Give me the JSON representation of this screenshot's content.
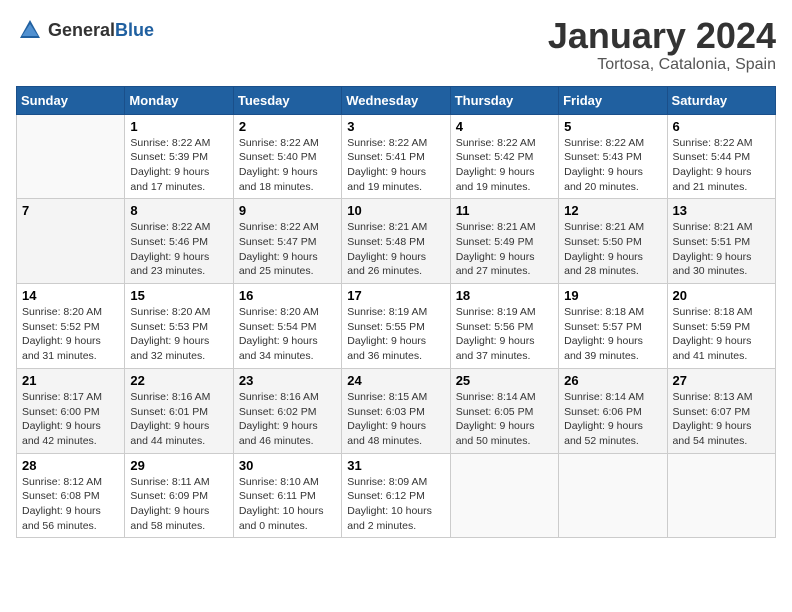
{
  "header": {
    "logo_general": "General",
    "logo_blue": "Blue",
    "title": "January 2024",
    "subtitle": "Tortosa, Catalonia, Spain"
  },
  "calendar": {
    "days_of_week": [
      "Sunday",
      "Monday",
      "Tuesday",
      "Wednesday",
      "Thursday",
      "Friday",
      "Saturday"
    ],
    "weeks": [
      [
        {
          "day": "",
          "info": ""
        },
        {
          "day": "1",
          "info": "Sunrise: 8:22 AM\nSunset: 5:39 PM\nDaylight: 9 hours\nand 17 minutes."
        },
        {
          "day": "2",
          "info": "Sunrise: 8:22 AM\nSunset: 5:40 PM\nDaylight: 9 hours\nand 18 minutes."
        },
        {
          "day": "3",
          "info": "Sunrise: 8:22 AM\nSunset: 5:41 PM\nDaylight: 9 hours\nand 19 minutes."
        },
        {
          "day": "4",
          "info": "Sunrise: 8:22 AM\nSunset: 5:42 PM\nDaylight: 9 hours\nand 19 minutes."
        },
        {
          "day": "5",
          "info": "Sunrise: 8:22 AM\nSunset: 5:43 PM\nDaylight: 9 hours\nand 20 minutes."
        },
        {
          "day": "6",
          "info": "Sunrise: 8:22 AM\nSunset: 5:44 PM\nDaylight: 9 hours\nand 21 minutes."
        }
      ],
      [
        {
          "day": "7",
          "info": ""
        },
        {
          "day": "8",
          "info": "Sunrise: 8:22 AM\nSunset: 5:46 PM\nDaylight: 9 hours\nand 23 minutes."
        },
        {
          "day": "9",
          "info": "Sunrise: 8:22 AM\nSunset: 5:47 PM\nDaylight: 9 hours\nand 25 minutes."
        },
        {
          "day": "10",
          "info": "Sunrise: 8:21 AM\nSunset: 5:48 PM\nDaylight: 9 hours\nand 26 minutes."
        },
        {
          "day": "11",
          "info": "Sunrise: 8:21 AM\nSunset: 5:49 PM\nDaylight: 9 hours\nand 27 minutes."
        },
        {
          "day": "12",
          "info": "Sunrise: 8:21 AM\nSunset: 5:50 PM\nDaylight: 9 hours\nand 28 minutes."
        },
        {
          "day": "13",
          "info": "Sunrise: 8:21 AM\nSunset: 5:51 PM\nDaylight: 9 hours\nand 30 minutes."
        }
      ],
      [
        {
          "day": "14",
          "info": "Sunrise: 8:20 AM\nSunset: 5:52 PM\nDaylight: 9 hours\nand 31 minutes."
        },
        {
          "day": "15",
          "info": "Sunrise: 8:20 AM\nSunset: 5:53 PM\nDaylight: 9 hours\nand 32 minutes."
        },
        {
          "day": "16",
          "info": "Sunrise: 8:20 AM\nSunset: 5:54 PM\nDaylight: 9 hours\nand 34 minutes."
        },
        {
          "day": "17",
          "info": "Sunrise: 8:19 AM\nSunset: 5:55 PM\nDaylight: 9 hours\nand 36 minutes."
        },
        {
          "day": "18",
          "info": "Sunrise: 8:19 AM\nSunset: 5:56 PM\nDaylight: 9 hours\nand 37 minutes."
        },
        {
          "day": "19",
          "info": "Sunrise: 8:18 AM\nSunset: 5:57 PM\nDaylight: 9 hours\nand 39 minutes."
        },
        {
          "day": "20",
          "info": "Sunrise: 8:18 AM\nSunset: 5:59 PM\nDaylight: 9 hours\nand 41 minutes."
        }
      ],
      [
        {
          "day": "21",
          "info": "Sunrise: 8:17 AM\nSunset: 6:00 PM\nDaylight: 9 hours\nand 42 minutes."
        },
        {
          "day": "22",
          "info": "Sunrise: 8:16 AM\nSunset: 6:01 PM\nDaylight: 9 hours\nand 44 minutes."
        },
        {
          "day": "23",
          "info": "Sunrise: 8:16 AM\nSunset: 6:02 PM\nDaylight: 9 hours\nand 46 minutes."
        },
        {
          "day": "24",
          "info": "Sunrise: 8:15 AM\nSunset: 6:03 PM\nDaylight: 9 hours\nand 48 minutes."
        },
        {
          "day": "25",
          "info": "Sunrise: 8:14 AM\nSunset: 6:05 PM\nDaylight: 9 hours\nand 50 minutes."
        },
        {
          "day": "26",
          "info": "Sunrise: 8:14 AM\nSunset: 6:06 PM\nDaylight: 9 hours\nand 52 minutes."
        },
        {
          "day": "27",
          "info": "Sunrise: 8:13 AM\nSunset: 6:07 PM\nDaylight: 9 hours\nand 54 minutes."
        }
      ],
      [
        {
          "day": "28",
          "info": "Sunrise: 8:12 AM\nSunset: 6:08 PM\nDaylight: 9 hours\nand 56 minutes."
        },
        {
          "day": "29",
          "info": "Sunrise: 8:11 AM\nSunset: 6:09 PM\nDaylight: 9 hours\nand 58 minutes."
        },
        {
          "day": "30",
          "info": "Sunrise: 8:10 AM\nSunset: 6:11 PM\nDaylight: 10 hours\nand 0 minutes."
        },
        {
          "day": "31",
          "info": "Sunrise: 8:09 AM\nSunset: 6:12 PM\nDaylight: 10 hours\nand 2 minutes."
        },
        {
          "day": "",
          "info": ""
        },
        {
          "day": "",
          "info": ""
        },
        {
          "day": "",
          "info": ""
        }
      ]
    ]
  }
}
